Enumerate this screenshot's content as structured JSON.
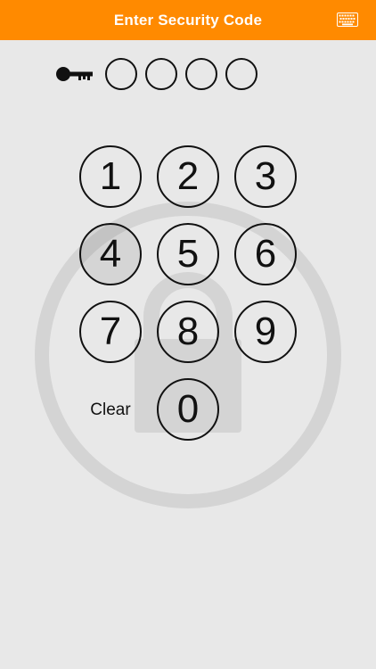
{
  "header": {
    "title": "Enter Security Code",
    "background": "#ff8a00",
    "keyboard_icon": "keyboard-icon"
  },
  "code_entry": {
    "key_icon": "key-icon",
    "slots": 4,
    "filled": 0
  },
  "keypad": {
    "keys": [
      "1",
      "2",
      "3",
      "4",
      "5",
      "6",
      "7",
      "8",
      "9",
      "0"
    ],
    "clear_label": "Clear",
    "pressed_key": "4"
  },
  "background": {
    "watermark_icon": "lock-icon",
    "color": "#e8e8e8"
  }
}
